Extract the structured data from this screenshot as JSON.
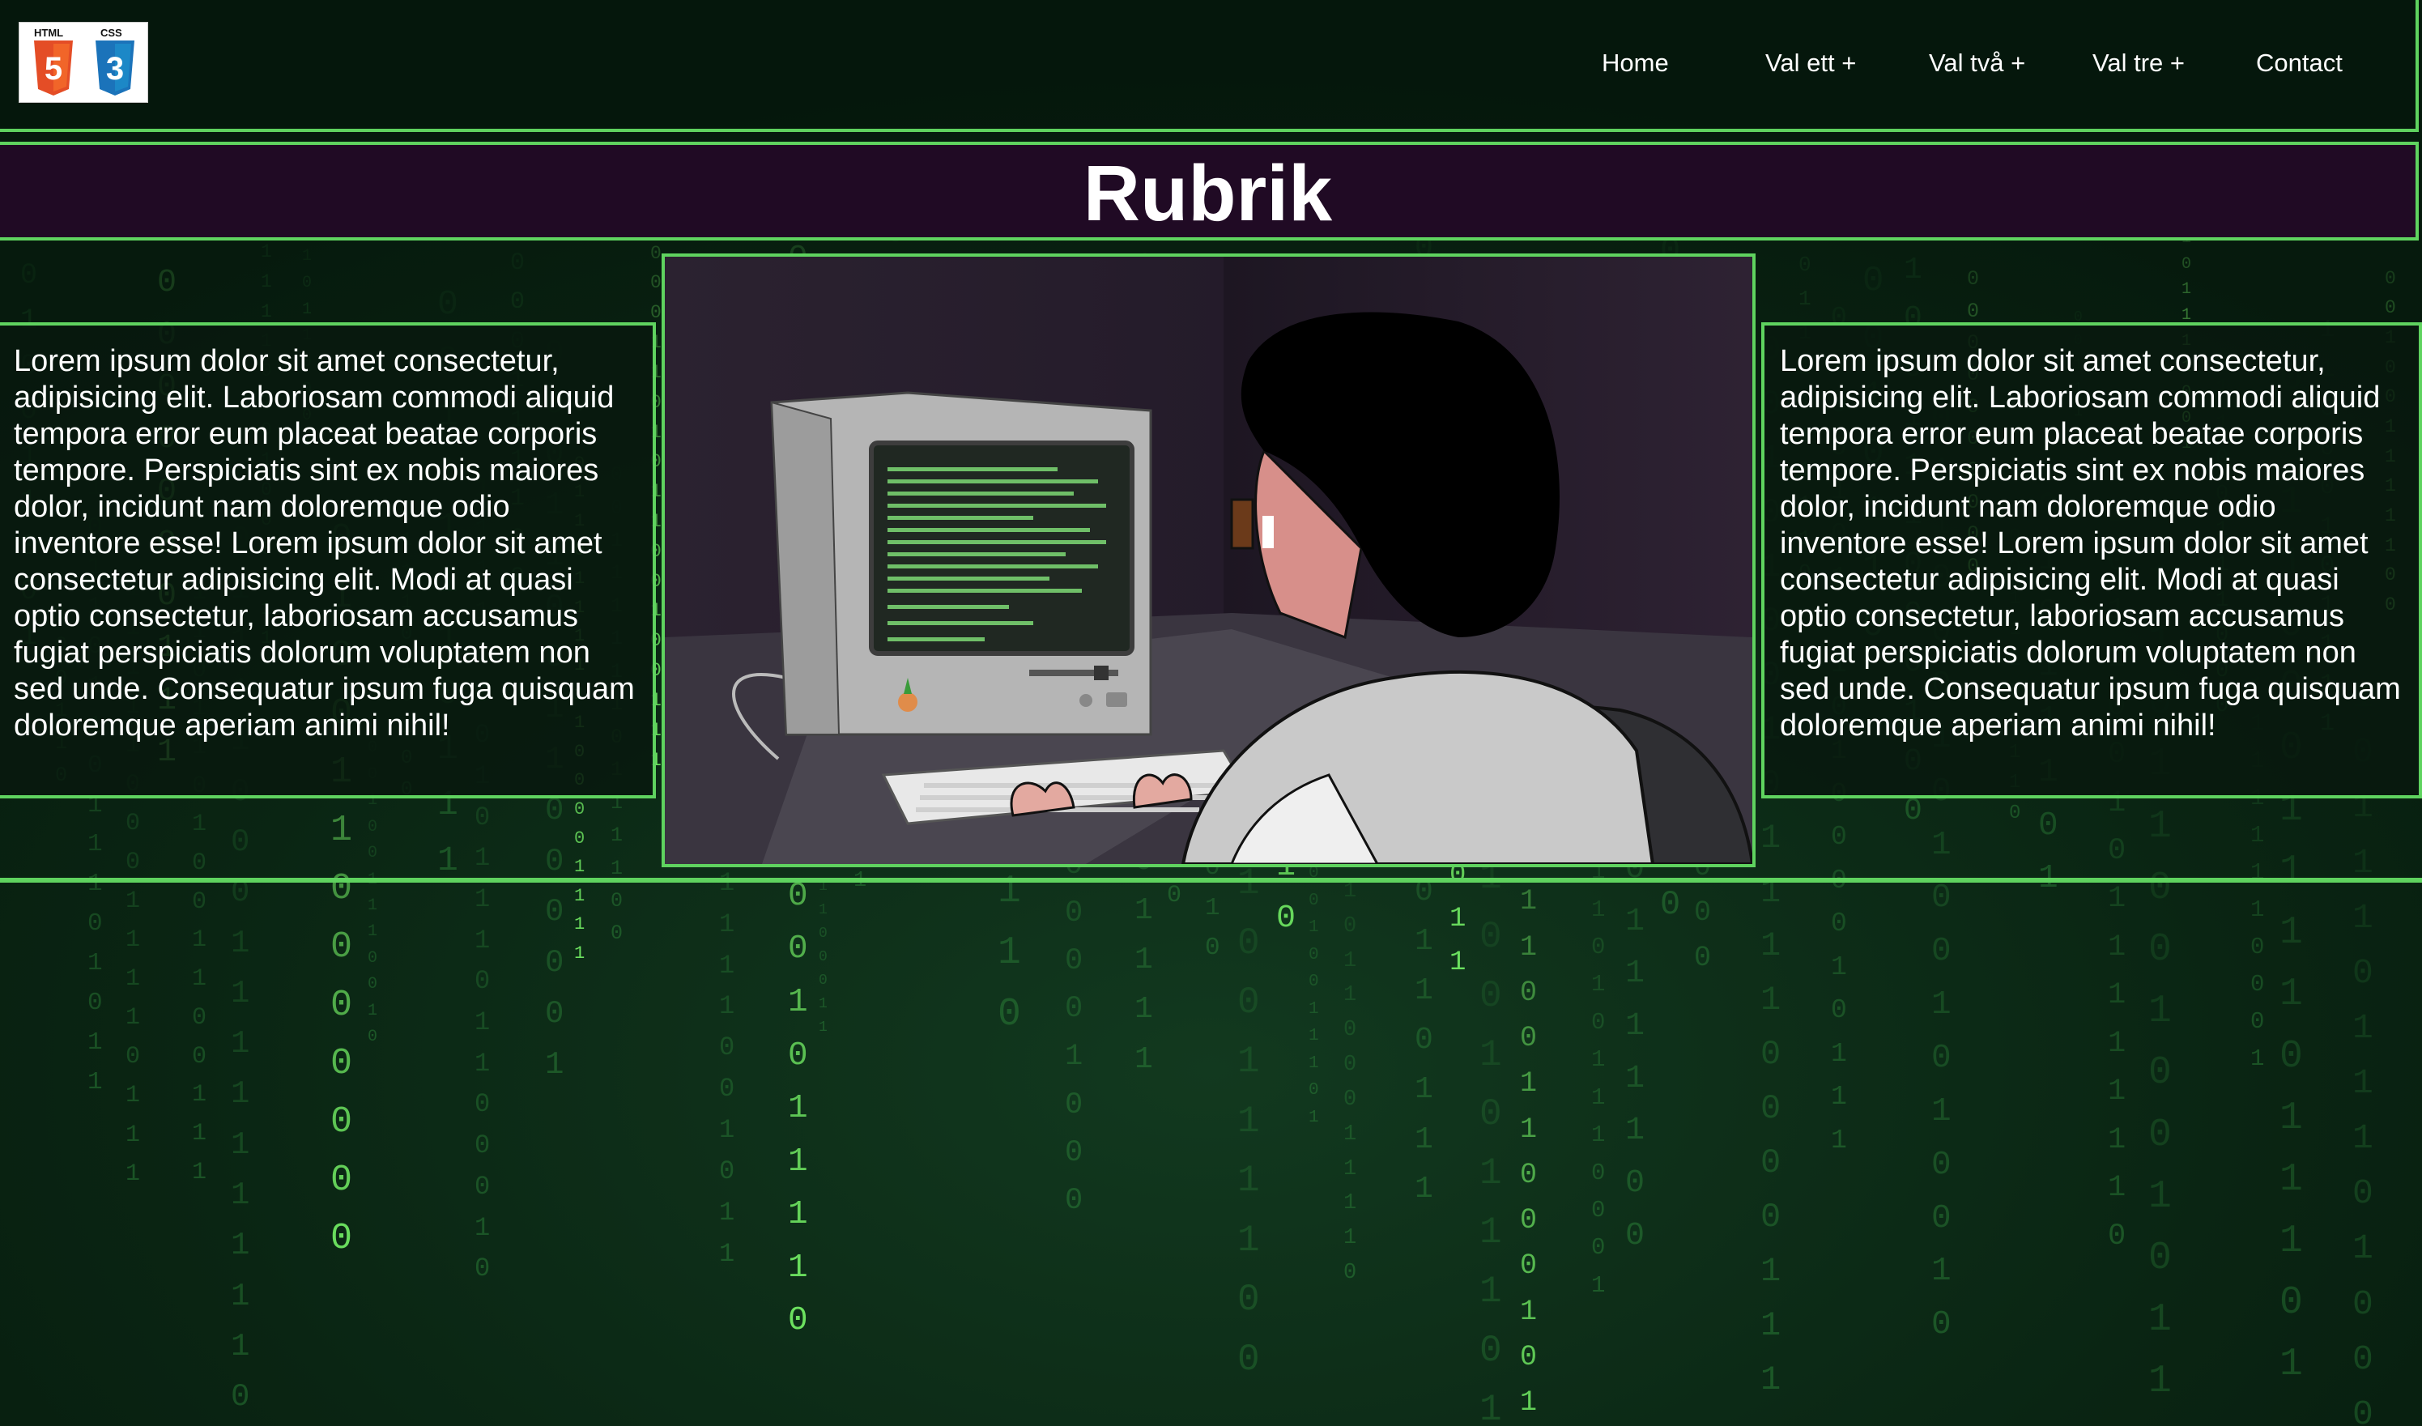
{
  "logo": {
    "html_tag": "HTML",
    "css_tag": "CSS",
    "html_number": "5",
    "css_number": "3"
  },
  "nav": {
    "items": [
      {
        "label": "Home"
      },
      {
        "label": "Val ett +"
      },
      {
        "label": "Val två +"
      },
      {
        "label": "Val tre +"
      },
      {
        "label": "Contact"
      }
    ]
  },
  "title": "Rubrik",
  "left_box": {
    "text": "Lorem ipsum dolor sit amet consectetur, adipisicing elit. Laboriosam commodi aliquid tempora error eum placeat beatae corporis tempore. Perspiciatis sint ex nobis maiores dolor, incidunt nam doloremque odio inventore esse! Lorem ipsum dolor sit amet consectetur adipisicing elit. Modi at quasi optio consectetur, laboriosam accusamus fugiat perspiciatis dolorum voluptatem non sed unde. Consequatur ipsum fuga quisquam doloremque aperiam animi nihil!"
  },
  "right_box": {
    "text": "Lorem ipsum dolor sit amet consectetur, adipisicing elit. Laboriosam commodi aliquid tempora error eum placeat beatae corporis tempore. Perspiciatis sint ex nobis maiores dolor, incidunt nam doloremque odio inventore esse! Lorem ipsum dolor sit amet consectetur adipisicing elit. Modi at quasi optio consectetur, laboriosam accusamus fugiat perspiciatis dolorum voluptatem non sed unde. Consequatur ipsum fuga quisquam doloremque aperiam animi nihil!"
  },
  "colors": {
    "accent_green": "#5fd35f",
    "title_band": "#200a24",
    "background": "#0b1f12",
    "html5_orange": "#e44d26",
    "css3_blue": "#1b73ba"
  }
}
